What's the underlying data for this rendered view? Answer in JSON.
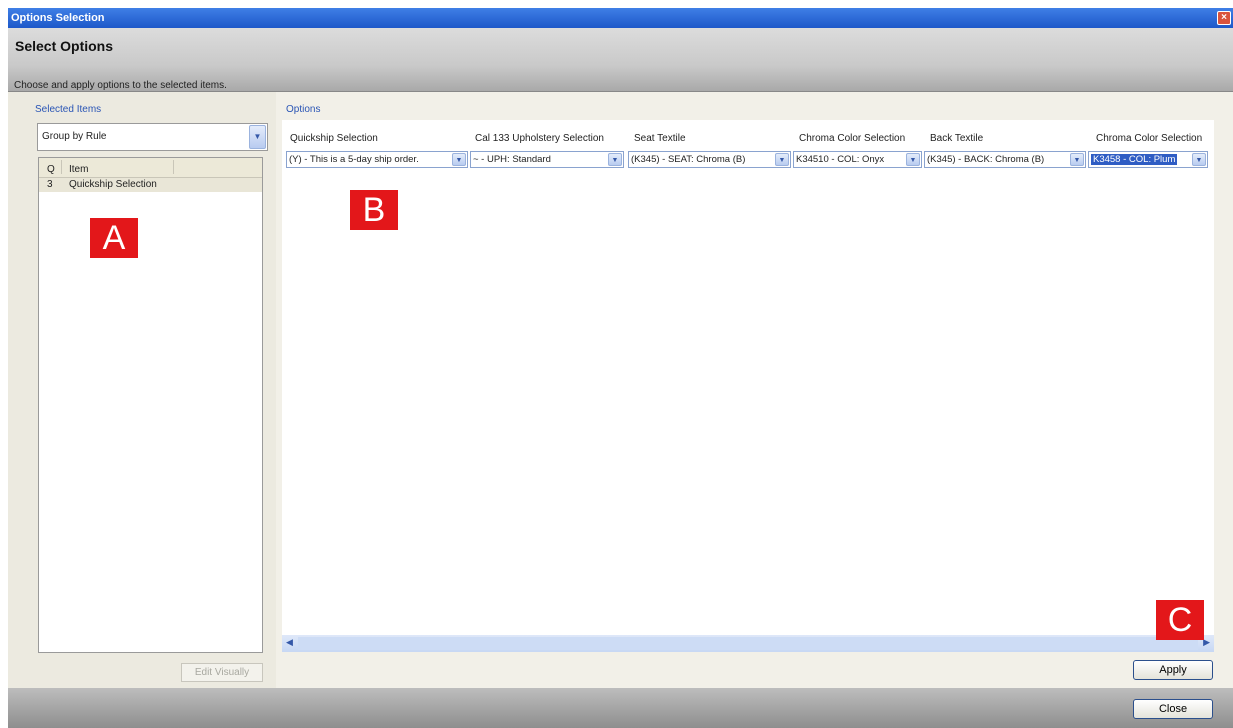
{
  "window": {
    "title": "Options Selection",
    "close_glyph": "×"
  },
  "header": {
    "title": "Select Options",
    "subtitle": "Choose and apply options to the selected items."
  },
  "left_pane": {
    "label": "Selected Items",
    "group_by": {
      "selected": "Group by Rule"
    },
    "list": {
      "columns": [
        "Q",
        "Item"
      ],
      "rows": [
        {
          "q": "3",
          "item": "Quickship Selection"
        }
      ]
    },
    "edit_button": "Edit Visually"
  },
  "right_pane": {
    "label": "Options",
    "columns": [
      {
        "header": "Quickship Selection",
        "value": "(Y) - This is a 5-day ship order."
      },
      {
        "header": "Cal 133 Upholstery Selection",
        "value": "~ - UPH: Standard"
      },
      {
        "header": "Seat Textile",
        "value": "(K345) - SEAT: Chroma (B)"
      },
      {
        "header": "Chroma Color Selection",
        "value": "K34510 - COL: Onyx"
      },
      {
        "header": "Back Textile",
        "value": "(K345) - BACK: Chroma (B)"
      },
      {
        "header": "Chroma Color Selection",
        "value": "K3458 - COL: Plum"
      }
    ],
    "apply_button": "Apply"
  },
  "footer": {
    "close_button": "Close"
  },
  "annotations": {
    "a": "A",
    "b": "B",
    "c": "C"
  },
  "icons": {
    "dropdown": "chevron-down-icon",
    "scroll_left": "scroll-left-icon",
    "scroll_right": "scroll-right-icon"
  },
  "colors": {
    "title_bar": "#1d58c9",
    "marker": "#e3171a",
    "link_label": "#2a55b5",
    "selection": "#2f5dc4"
  }
}
